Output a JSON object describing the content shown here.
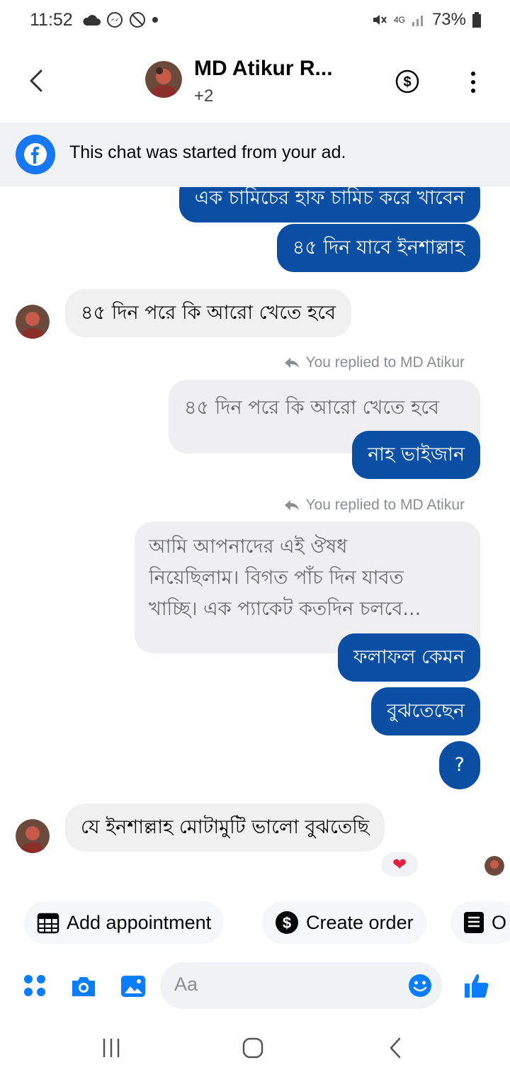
{
  "status_bar": {
    "time": "11:52",
    "battery": "73%",
    "network": "4G"
  },
  "header": {
    "contact_name": "MD Atikur R...",
    "participants_extra": "+2"
  },
  "banner": {
    "text": "This chat was started from your ad."
  },
  "messages": {
    "m1": "এক চামিচের হাফ চামিচ করে খাবেন",
    "m2": "৪৫ দিন যাবে ইনশাল্লাহ",
    "m3": "৪৫ দিন পরে কি আরো খেতে হবে",
    "reply_label_1": "You replied to MD Atikur",
    "quote1": "৪৫ দিন পরে কি আরো খেতে হবে",
    "m4": "নাহ ভাইজান",
    "reply_label_2": "You replied to MD Atikur",
    "quote2_line1": "আমি আপনাদের এই ঔষধ",
    "quote2_line2": "নিয়েছিলাম। বিগত পাঁচ দিন যাবত",
    "quote2_line3": "খাচ্ছি। এক প্যাকেট কতদিন চলবে...",
    "m5": "ফলাফল কেমন",
    "m6": "বুঝতেছেন",
    "m7": "?",
    "m8": "যে ইনশাল্লাহ মোটামুটি ভালো বুঝতেছি",
    "reaction": "❤"
  },
  "quick_actions": {
    "appointment": "Add appointment",
    "order": "Create order",
    "third": "O"
  },
  "composer": {
    "placeholder": "Aa"
  },
  "colors": {
    "outgoing_bubble": "#0a4fa3",
    "accent": "#1877f2",
    "incoming_bubble": "#f0f0f0"
  }
}
